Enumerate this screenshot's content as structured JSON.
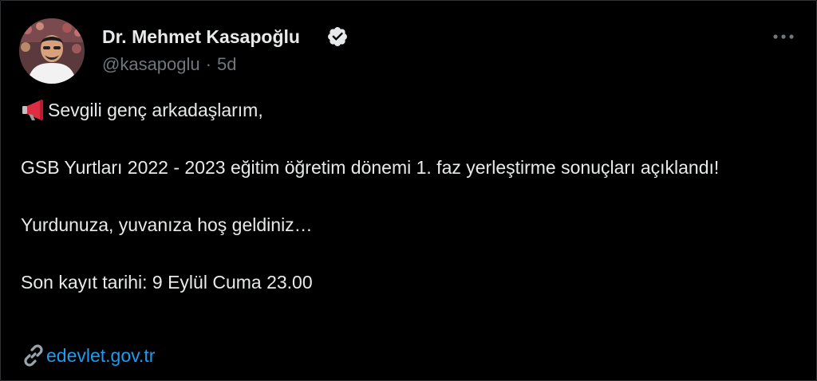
{
  "author": {
    "display_name": "Dr. Mehmet Kasapoğlu",
    "handle": "@kasapoglu",
    "separator": "·",
    "time": "5d",
    "verified_icon": "verified-badge-icon",
    "more_icon": "more-options-icon"
  },
  "tweet": {
    "lines": [
      "Sevgili genç arkadaşlarım,",
      "GSB Yurtları 2022 - 2023 eğitim öğretim dönemi 1. faz yerleştirme sonuçları açıklandı!",
      "Yurdunuza, yuvanıza hoş geldiniz…",
      "Son kayıt tarihi: 9 Eylül Cuma 23.00"
    ],
    "lead_icon": "megaphone-icon",
    "link_icon": "link-icon",
    "link_text": "edevlet.gov.tr"
  },
  "colors": {
    "background": "#000000",
    "text": "#e7e9ea",
    "muted": "#71767b",
    "link": "#1d9bf0",
    "border": "#2f3336"
  }
}
